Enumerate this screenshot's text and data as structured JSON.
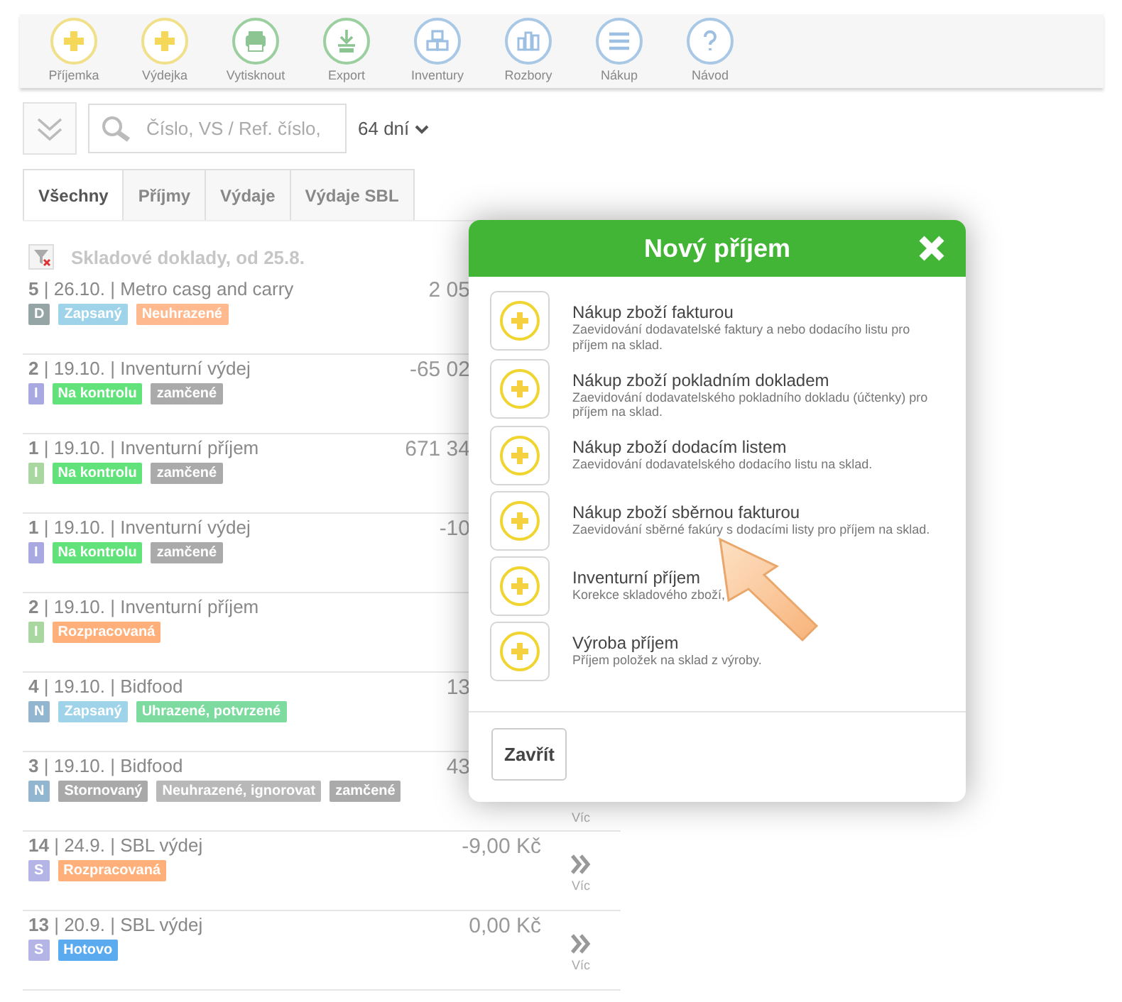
{
  "toolbar": [
    {
      "label": "Příjemka",
      "kind": "plus"
    },
    {
      "label": "Výdejka",
      "kind": "plus"
    },
    {
      "label": "Vytisknout",
      "kind": "print"
    },
    {
      "label": "Export",
      "kind": "export"
    },
    {
      "label": "Inventury",
      "kind": "boxes"
    },
    {
      "label": "Rozbory",
      "kind": "chart"
    },
    {
      "label": "Nákup",
      "kind": "menu"
    },
    {
      "label": "Návod",
      "kind": "help"
    }
  ],
  "search": {
    "placeholder": "Číslo, VS / Ref. číslo,",
    "period": "64 dní"
  },
  "tabs": [
    {
      "label": "Všechny",
      "selected": true
    },
    {
      "label": "Příjmy",
      "selected": false
    },
    {
      "label": "Výdaje",
      "selected": false
    },
    {
      "label": "Výdaje SBL",
      "selected": false
    }
  ],
  "list": {
    "heading": "Skladové doklady, od 25.8.",
    "rows": [
      {
        "title": "**5** | 26.10. | Metro casg and carry",
        "amount": "2 05",
        "badges": [
          {
            "text": "D",
            "color": "#95a5a6"
          },
          {
            "text": "Zapsaný",
            "color": "#9fd3ea"
          },
          {
            "text": "Neuhrazené",
            "color": "#ffb98e"
          }
        ]
      },
      {
        "title": "**2** | 19.10. | Inventurní výdej",
        "amount": "-65 02",
        "badges": [
          {
            "text": "I",
            "color": "#a9a9e2"
          },
          {
            "text": "Na kontrolu",
            "color": "#62e27a"
          },
          {
            "text": "zamčené",
            "color": "#aaaaaa"
          }
        ]
      },
      {
        "title": "**1** | 19.10. | Inventurní příjem",
        "amount": "671 34",
        "badges": [
          {
            "text": "I",
            "color": "#a8d8a0"
          },
          {
            "text": "Na kontrolu",
            "color": "#62e27a"
          },
          {
            "text": "zamčené",
            "color": "#aaaaaa"
          }
        ]
      },
      {
        "title": "**1** | 19.10. | Inventurní výdej",
        "amount": "-10",
        "badges": [
          {
            "text": "I",
            "color": "#a9a9e2"
          },
          {
            "text": "Na kontrolu",
            "color": "#62e27a"
          },
          {
            "text": "zamčené",
            "color": "#aaaaaa"
          }
        ]
      },
      {
        "title": "**2** | 19.10. | Inventurní příjem",
        "badges": [
          {
            "text": "I",
            "color": "#a8d8a0"
          },
          {
            "text": "Rozpracovaná",
            "color": "#ffb07a"
          }
        ]
      },
      {
        "title": "**4** | 19.10. | Bidfood",
        "amount": "13",
        "badges": [
          {
            "text": "N",
            "color": "#92b6cf"
          },
          {
            "text": "Zapsaný",
            "color": "#9fd3ea"
          },
          {
            "text": "Uhrazené, potvrzené",
            "color": "#7ddba0"
          }
        ]
      },
      {
        "title": "**3** | 19.10. | Bidfood",
        "amount": "43",
        "more_chevron": false,
        "more_label": "Víc",
        "badges": [
          {
            "text": "N",
            "color": "#92b6cf"
          },
          {
            "text": "Stornovaný",
            "color": "#a9a9a9"
          },
          {
            "text": "Neuhrazené, ignorovat",
            "color": "#b8b8b8"
          },
          {
            "text": "zamčené",
            "color": "#aaaaaa"
          }
        ]
      },
      {
        "title": "**14** | 24.9. | SBL výdej",
        "amount": "-9,00 Kč",
        "more_chevron": true,
        "more_label": "Víc",
        "badges": [
          {
            "text": "S",
            "color": "#b4b4e6"
          },
          {
            "text": "Rozpracovaná",
            "color": "#ffb07a"
          }
        ]
      },
      {
        "title": "**13** | 20.9. | SBL výdej",
        "amount": "0,00 Kč",
        "more_chevron": true,
        "more_label": "Víc",
        "badges": [
          {
            "text": "S",
            "color": "#b4b4e6"
          },
          {
            "text": "Hotovo",
            "color": "#5aaaf0"
          }
        ]
      }
    ]
  },
  "dialog": {
    "title": "Nový příjem",
    "options": [
      {
        "title": "Nákup zboží fakturou",
        "description": "Zaevidování dodavatelské faktury a nebo dodacího listu pro příjem na sklad."
      },
      {
        "title": "Nákup zboží pokladním dokladem",
        "description": "Zaevidování dodavatelského pokladního dokladu (účtenky) pro příjem na sklad."
      },
      {
        "title": "Nákup zboží dodacím listem",
        "description": "Zaevidování dodavatelského dodacího listu na sklad."
      },
      {
        "title": "Nákup zboží sběrnou fakturou",
        "description": "Zaevidování sběrné fakúry s dodacími listy pro příjem na sklad."
      },
      {
        "title": "Inventurní příjem",
        "description": "Korekce skladového zboží,"
      },
      {
        "title": "Výroba příjem",
        "description": "Příjem položek na sklad z výroby."
      }
    ],
    "close_button": "Zavřít"
  }
}
